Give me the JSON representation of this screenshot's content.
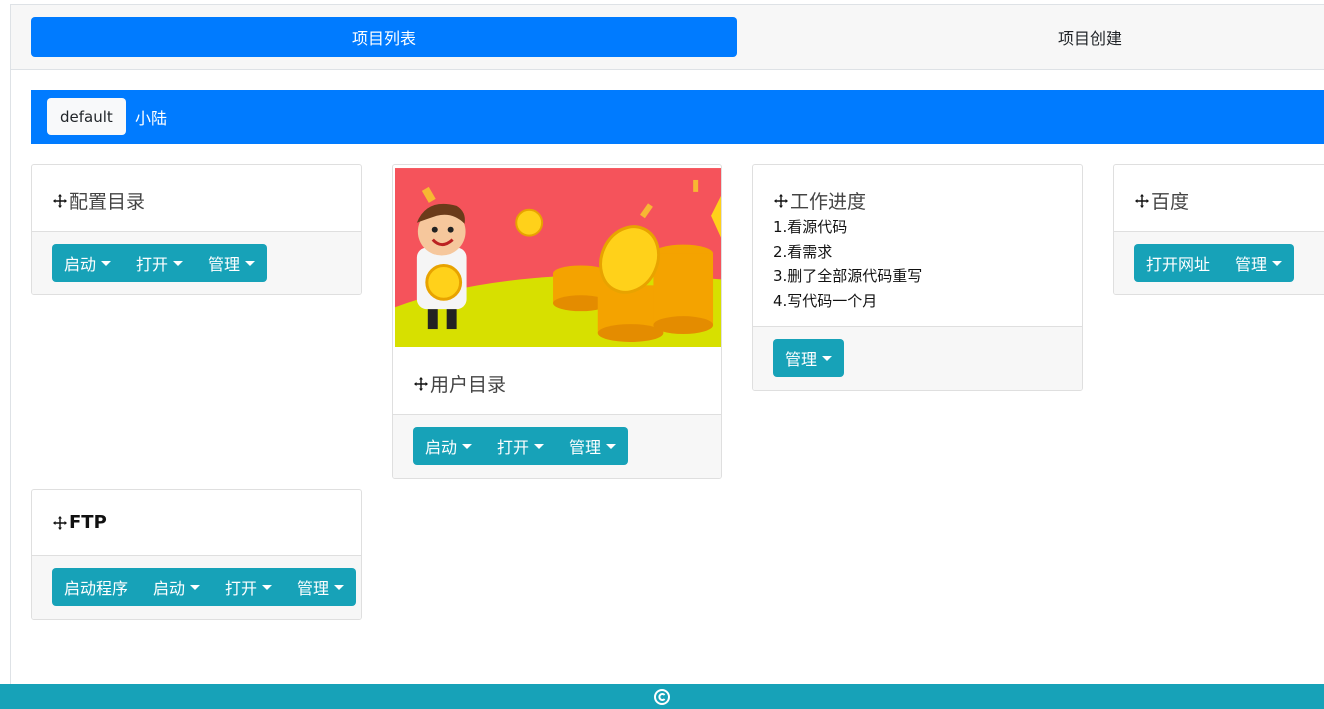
{
  "nav": {
    "tabs": [
      {
        "label": "项目列表"
      },
      {
        "label": "项目创建"
      }
    ]
  },
  "groups": [
    {
      "label": "default"
    },
    {
      "label": "小陆"
    }
  ],
  "cards": {
    "config": {
      "title": "配置目录",
      "buttons": [
        "启动",
        "打开",
        "管理"
      ]
    },
    "user": {
      "title": "用户目录",
      "buttons": [
        "启动",
        "打开",
        "管理"
      ],
      "image": "cartoon-man-with-gold-coins"
    },
    "progress": {
      "title": "工作进度",
      "lines": [
        "1.看源代码",
        "2.看需求",
        "3.删了全部源代码重写",
        "4.写代码一个月"
      ],
      "buttons": [
        "管理"
      ]
    },
    "baidu": {
      "title": "百度",
      "buttons": [
        "打开网址",
        "管理"
      ]
    },
    "ftp": {
      "title": "FTP",
      "buttons": [
        "启动程序",
        "启动",
        "打开",
        "管理"
      ]
    }
  },
  "colors": {
    "primary": "#007bff",
    "info": "#17a2b8",
    "card_footer": "#f7f7f7"
  },
  "icons": {
    "title_icon": "move-icon",
    "footer_icon": "copyright-icon"
  }
}
